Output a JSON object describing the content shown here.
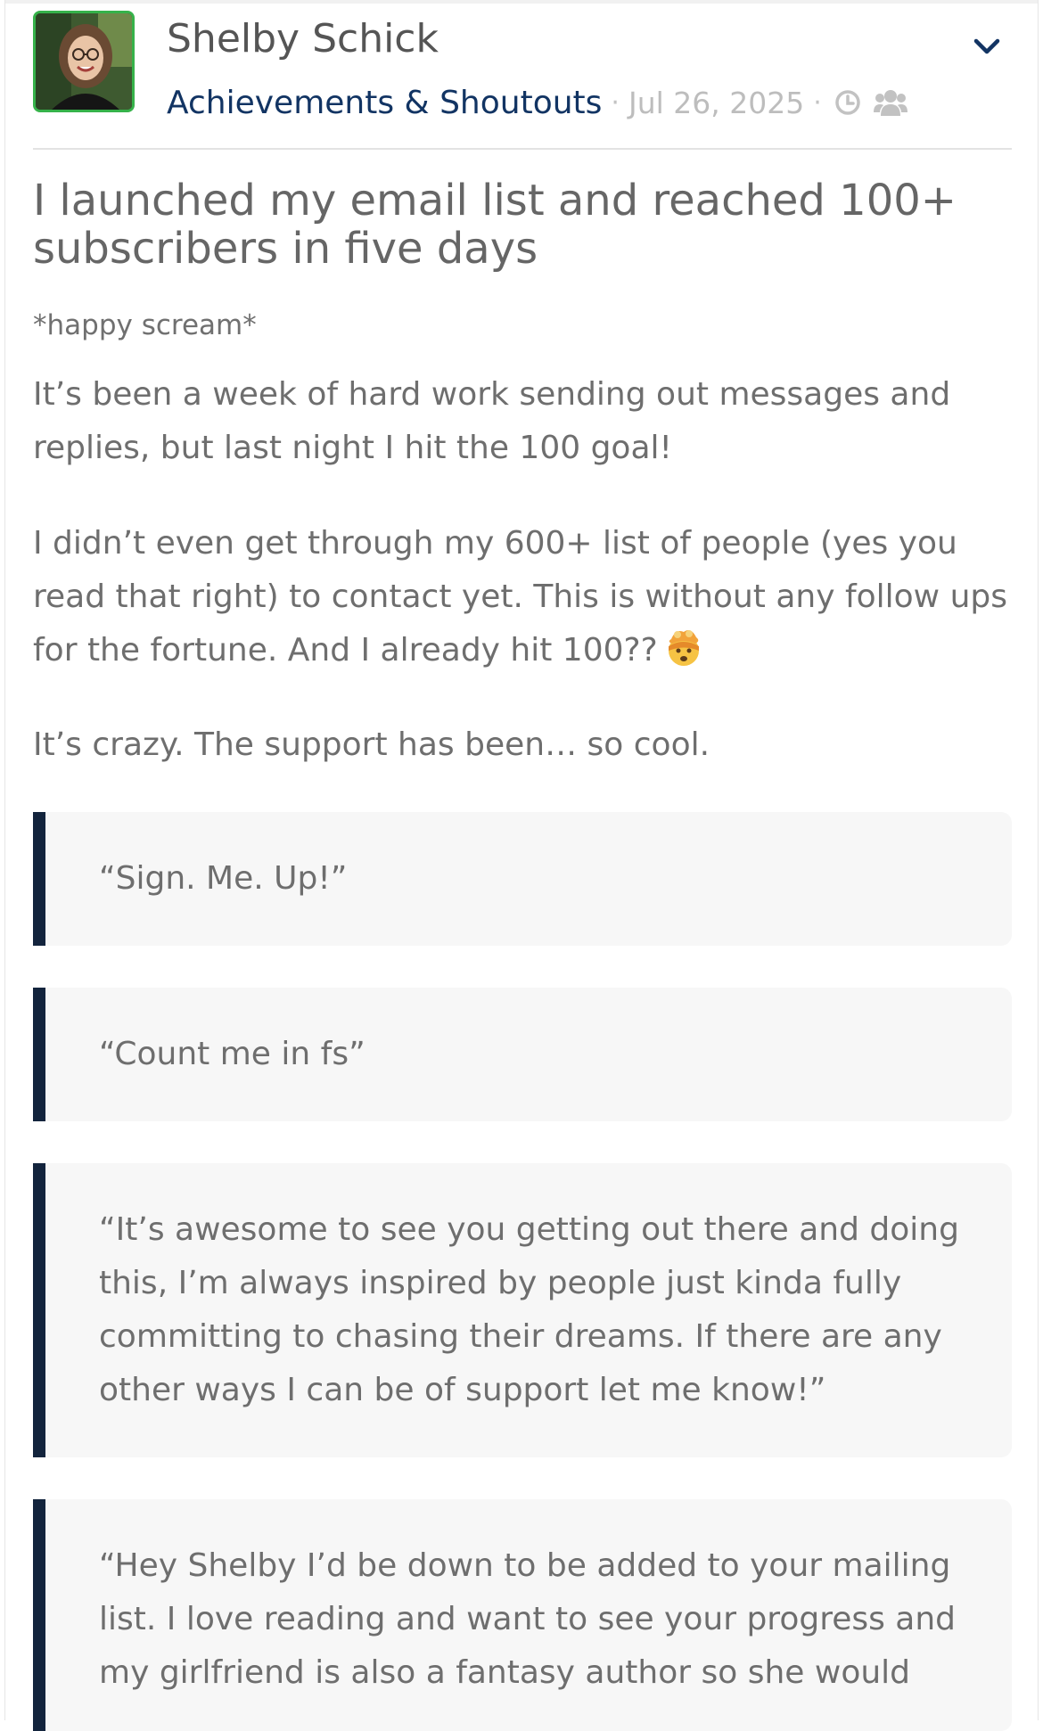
{
  "post": {
    "author_name": "Shelby Schick",
    "category": "Achievements & Shoutouts",
    "separator": "·",
    "date": "Jul 26, 2025",
    "title": "I launched my email list and reached 100+ subscribers in five days",
    "subtitle": "*happy scream*",
    "paragraphs": [
      "It’s been a week of hard work sending out messages and replies, but last night I hit the 100 goal!",
      "I didn’t even get through my 600+ list of people (yes you read that right) to contact yet. This is without any follow ups for the fortune. And I already hit 100??",
      "It’s crazy. The support has been… so cool."
    ],
    "quotes": [
      "“Sign. Me. Up!”",
      "“Count me in fs”",
      "“It’s awesome to see you getting out there and doing this, I’m always inspired by people just kinda fully committing to chasing their dreams. If there are any other ways I can be of support let me know!”",
      "“Hey Shelby I’d be down to be added to your mailing list. I love reading and want to see your progress and my girlfriend is also a fantasy author so she would"
    ]
  },
  "icons": {
    "avatar": "author-photo",
    "menu": "chevron-down-icon",
    "time": "clock-icon",
    "visibility": "group-icon",
    "emoji": "exploding-head-emoji"
  },
  "colors": {
    "accent": "#123463",
    "avatar_border": "#36b24a",
    "quote_bar": "#13243d",
    "quote_bg": "#f7f7f7"
  }
}
